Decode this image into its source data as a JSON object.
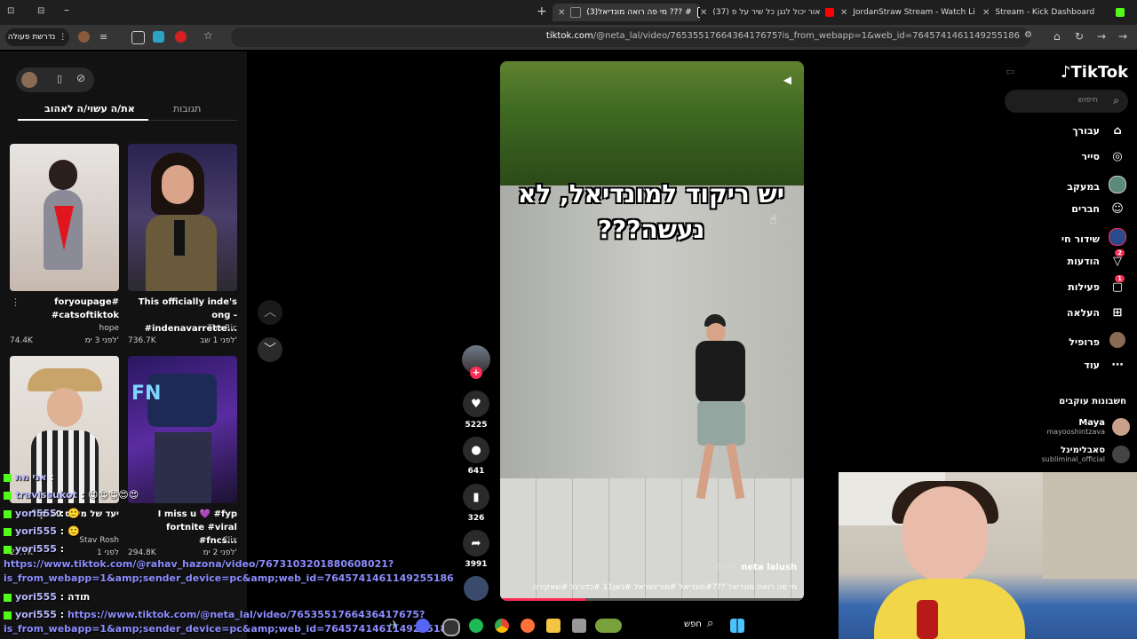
{
  "browser": {
    "tabs": [
      {
        "title": "Stream - Kick Dashboard",
        "active": false,
        "fav_color": "#53fc18"
      },
      {
        "title": "JordanStraw Stream - Watch Li",
        "active": false,
        "fav_color": "#53fc18"
      },
      {
        "title": "(37) אור יכול לנגן כל שיר על פ",
        "active": false,
        "fav_color": "#ff0000"
      },
      {
        "title": "(3)מי פה רואה מונדיאל ??? #",
        "active": true,
        "fav_color": "#ffffff"
      }
    ],
    "url_domain": "tiktok.com",
    "url_path": "/@neta_lal/video/7653551766436417675?is_from_webapp=1&web_id=7645741461149255186",
    "pill_label": "נדרשת פעולה"
  },
  "left_panel": {
    "tab_foryou": "את/ה עשוי/ה לאהוב",
    "tab_comments": "תגובות",
    "cards": [
      {
        "title1": "foryoupage#",
        "title2": "#catsoftiktok",
        "author": "hope",
        "views": "74.4K",
        "age": "לפני 3 ימ'"
      },
      {
        "title1": "This officially inde's",
        "title2": "ong - #indenavarrette...",
        "author": "The Ric",
        "views": "736.7K",
        "age": "לפני 1 שב'"
      },
      {
        "title1": "יעד של מינוס 10 קילו",
        "title2": "",
        "author": "Stav Rosh",
        "views": "22.7K",
        "age": "לפני 1"
      },
      {
        "title1": "I miss u 💜 #fyp",
        "title2": "fortnite #viral #fncs...",
        "author": "Clix",
        "views": "294.8K",
        "age": "לפני 2 ימ'"
      }
    ]
  },
  "video": {
    "overlay_text": "יש ריקוד למונדיאל, לא נעשה???",
    "author": "neta lalush",
    "date": "6-20",
    "caption": "מי פה רואה מונדיאל ???#מונדיאל #פוריושראל #כאן11 #כדורגל #שאקירה",
    "progress_pct": 28
  },
  "actions": {
    "likes": "5225",
    "comments": "641",
    "saves": "326",
    "shares": "3991"
  },
  "sidebar": {
    "logo": "TikTok",
    "search_placeholder": "חיפוש",
    "nav": [
      {
        "label": "עבורך",
        "icon": "⌂",
        "name": "home"
      },
      {
        "label": "סייר",
        "icon": "◎",
        "name": "explore"
      },
      {
        "label": "במעקב",
        "icon": "●",
        "name": "following"
      },
      {
        "label": "חברים",
        "icon": "☺",
        "name": "friends"
      },
      {
        "label": "שידור חי",
        "icon": "◉",
        "name": "live"
      },
      {
        "label": "הודעות",
        "icon": "▽",
        "name": "messages",
        "badge": "2"
      },
      {
        "label": "פעילות",
        "icon": "▢",
        "name": "activity",
        "badge": "1"
      },
      {
        "label": "העלאה",
        "icon": "⊞",
        "name": "upload"
      },
      {
        "label": "פרופיל",
        "icon": "●",
        "name": "profile"
      },
      {
        "label": "עוד",
        "icon": "⋯",
        "name": "more"
      }
    ],
    "following_header": "חשבונות עוקבים",
    "following": [
      {
        "name": "Maya",
        "handle": "mayooshintzava"
      },
      {
        "name": "סאבלימינל",
        "handle": "subliminal_official"
      }
    ]
  },
  "chat": [
    {
      "user": "אני מת",
      "text": ""
    },
    {
      "user": "travissukot",
      "text": "😍😍😍😍😍"
    },
    {
      "user": "yori555",
      "text": "🙂"
    },
    {
      "user": "yori555",
      "text": "🙂"
    },
    {
      "user": "yori555",
      "text": ""
    },
    {
      "url": "https://www.tiktok.com/@rahav_hazona/video/7673103201880608021?"
    },
    {
      "url": "is_from_webapp=1&amp;sender_device=pc&amp;web_id=7645741461149255186"
    },
    {
      "user": "yori555",
      "text": "תודה"
    },
    {
      "user": "yori555",
      "url": "https://www.tiktok.com/@neta_lal/video/7653551766436417675?"
    },
    {
      "url": "is_from_webapp=1&amp;sender_device=pc&amp;web_id=7645741461149255186"
    }
  ],
  "taskbar": {
    "search_label": "חפש"
  }
}
